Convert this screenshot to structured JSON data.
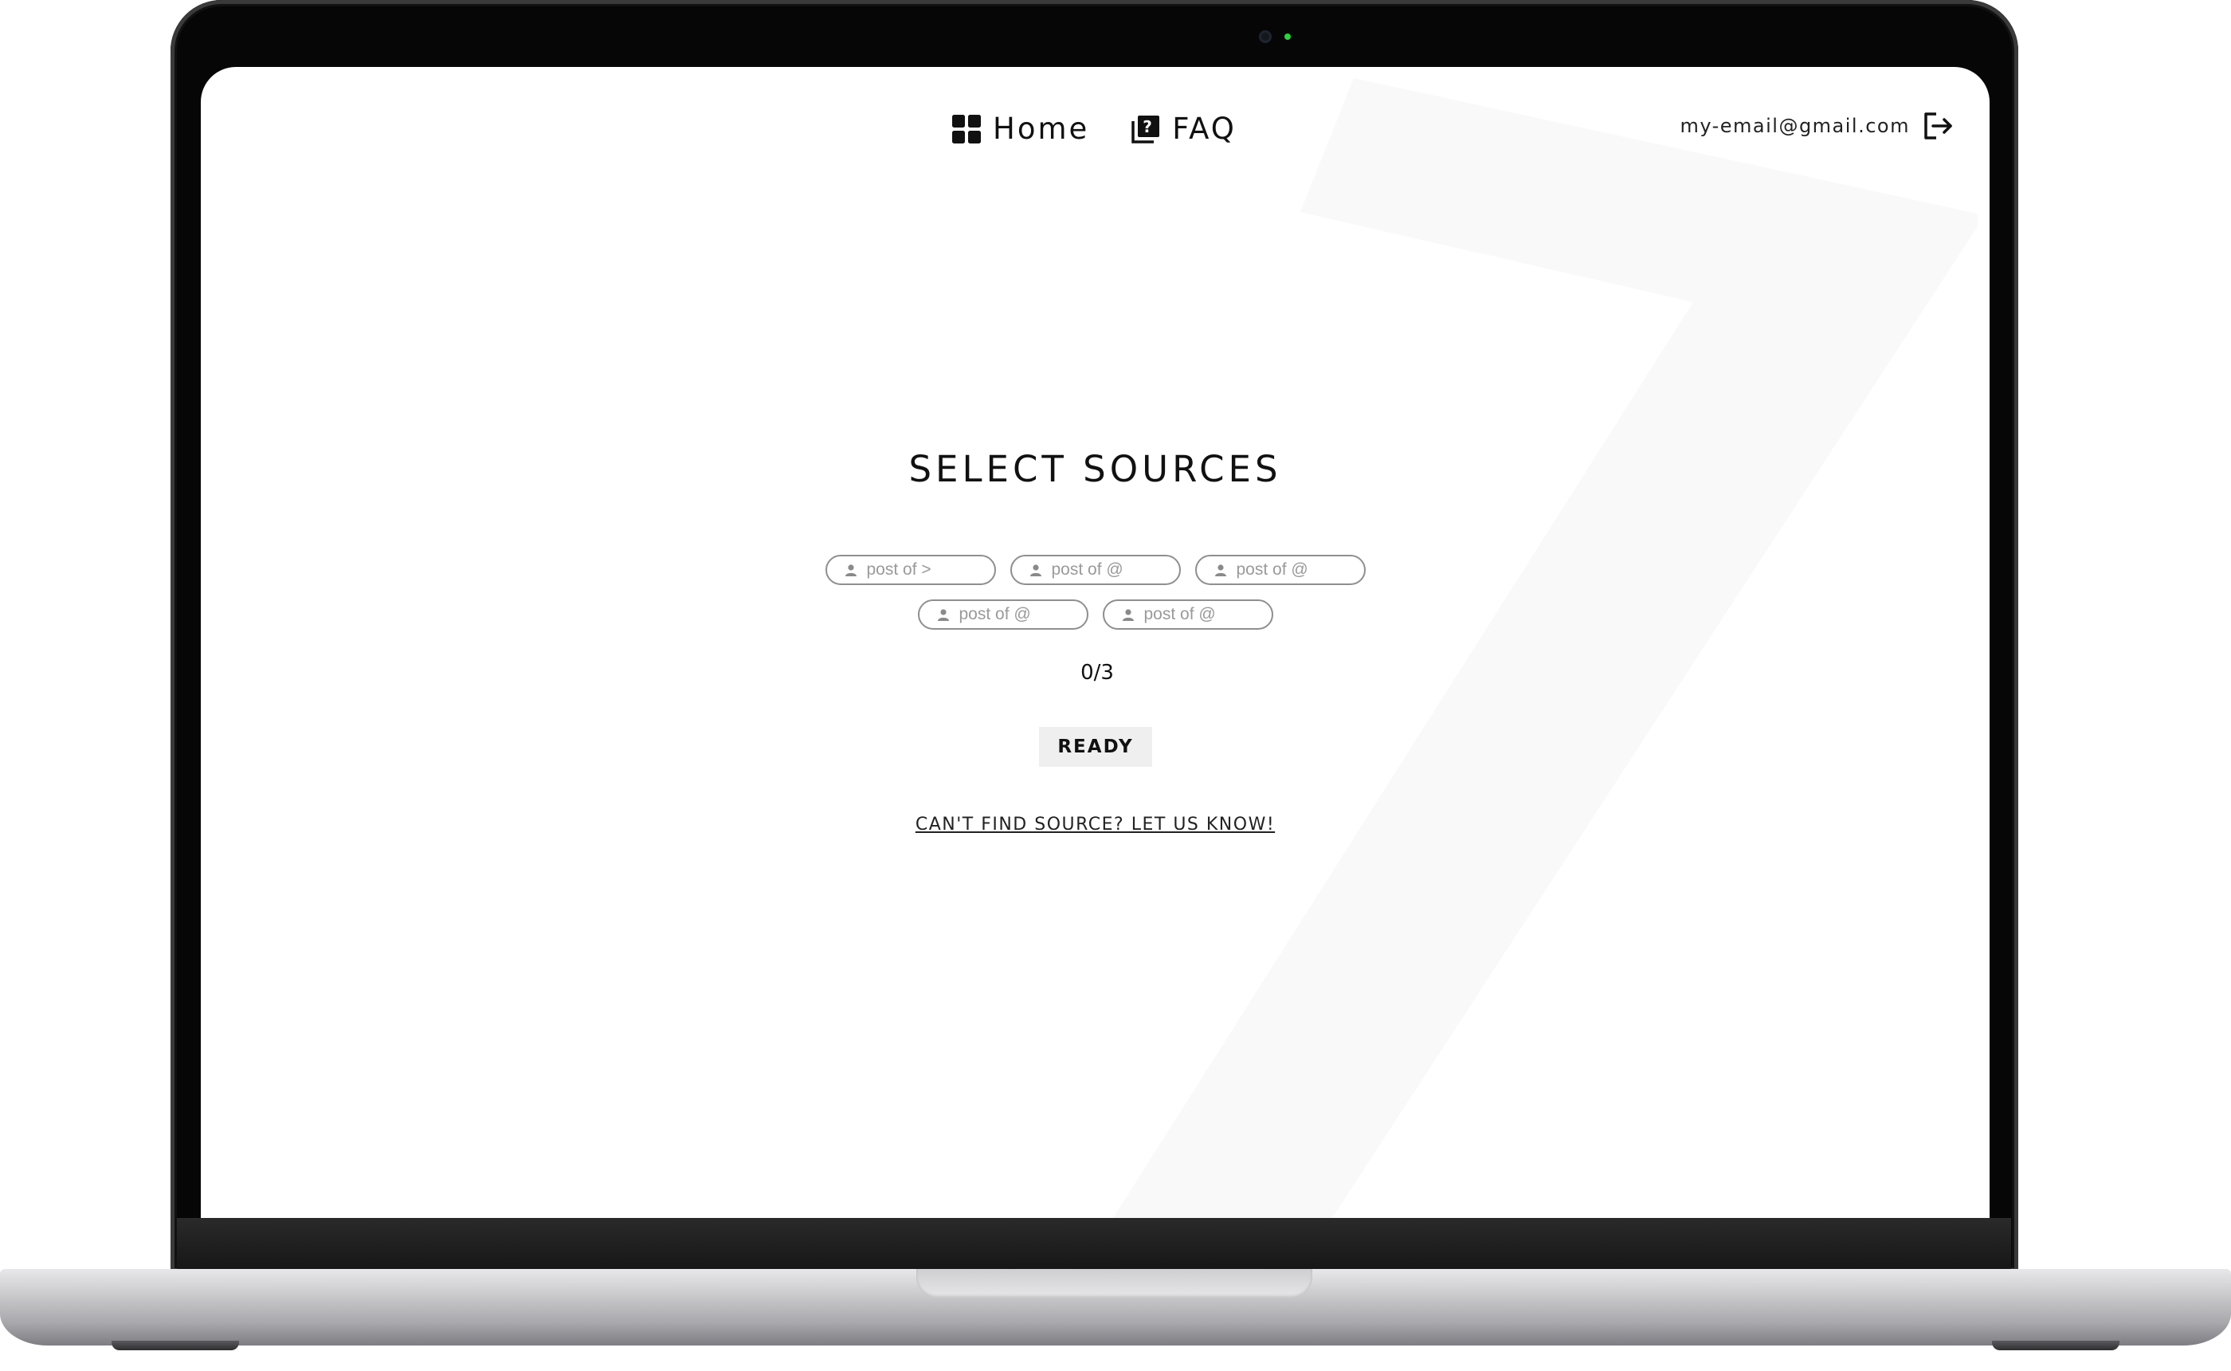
{
  "nav": {
    "home_label": "Home",
    "faq_label": "FAQ",
    "home_icon": "dashboard-grid-icon",
    "faq_icon": "help-book-icon"
  },
  "account": {
    "email": "my-email@gmail.com",
    "logout_icon": "logout-icon"
  },
  "main": {
    "title": "SELECT SOURCES",
    "sources": [
      {
        "label": "post of >",
        "icon": "person-icon"
      },
      {
        "label": "post of @",
        "icon": "person-icon"
      },
      {
        "label": "post of @",
        "icon": "person-icon"
      },
      {
        "label": "post of @",
        "icon": "person-icon"
      },
      {
        "label": "post of @",
        "icon": "person-icon"
      }
    ],
    "counter": "0/3",
    "ready_label": "READY",
    "help_link": "CAN'T FIND SOURCE? LET US KNOW!"
  },
  "colors": {
    "background": "#ffffff",
    "text": "#111111",
    "pill_border": "#8f8f8f",
    "pill_text": "#9a9a9a",
    "button_bg": "#efefef",
    "watermark": "#f9f9f9"
  }
}
